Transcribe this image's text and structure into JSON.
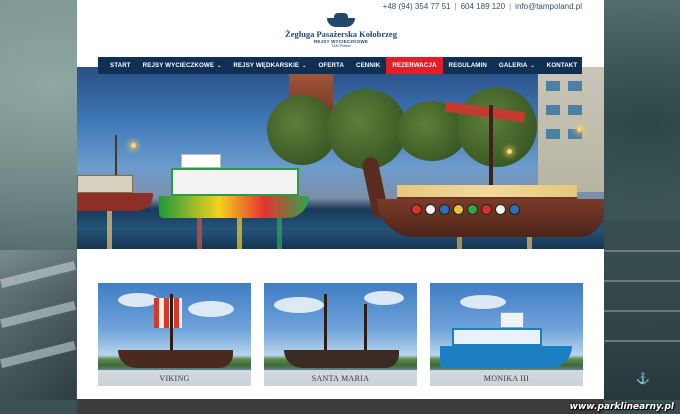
{
  "header": {
    "logo_title": "Żegluga Pasażerska Kołobrzeg",
    "logo_subtitle": "REJSY WYCIECZKOWE",
    "logo_tagline": "TAM Poland",
    "phone1": "+48 (94) 354 77 51",
    "phone2": "604 189 120",
    "email": "info@tampoland.pl"
  },
  "nav": {
    "items": [
      {
        "label": "START",
        "dropdown": false,
        "active": false
      },
      {
        "label": "REJSY WYCIECZKOWE",
        "dropdown": true,
        "active": false
      },
      {
        "label": "REJSY WĘDKARSKIE",
        "dropdown": true,
        "active": false
      },
      {
        "label": "OFERTA",
        "dropdown": false,
        "active": false
      },
      {
        "label": "CENNIK",
        "dropdown": false,
        "active": false
      },
      {
        "label": "REZERWACJA",
        "dropdown": false,
        "active": true
      },
      {
        "label": "REGULAMIN",
        "dropdown": false,
        "active": false
      },
      {
        "label": "GALERIA",
        "dropdown": true,
        "active": false
      },
      {
        "label": "KONTAKT",
        "dropdown": false,
        "active": false
      }
    ],
    "caret": "⌄"
  },
  "cards": [
    {
      "label": "VIKING"
    },
    {
      "label": "SANTA MARIA"
    },
    {
      "label": "MONIKA III"
    }
  ],
  "colors": {
    "nav_bg": "#0f2f54",
    "nav_active": "#e21f26",
    "brand": "#22486f"
  },
  "icons": {
    "anchor": "anchor-icon"
  },
  "watermark": "www.parklinearny.pl"
}
